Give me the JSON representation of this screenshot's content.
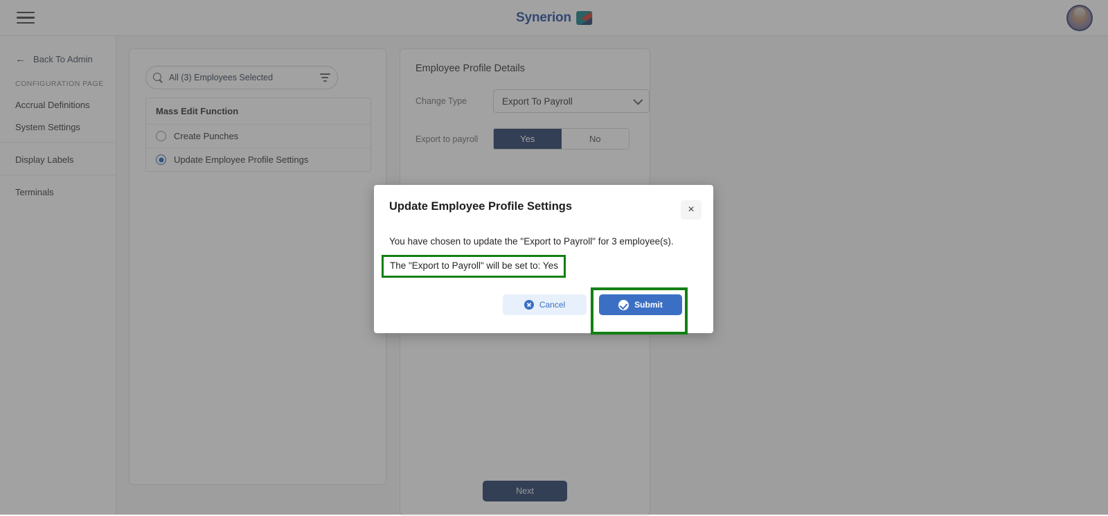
{
  "header": {
    "menu_icon": "hamburger-menu-icon",
    "logo_text": "Synerion",
    "logo_mark_icon": "synerion-logo-mark",
    "avatar_icon": "user-avatar"
  },
  "sidebar": {
    "back_arrow_icon": "arrow-left-icon",
    "back_label": "Back To Admin",
    "section_title": "CONFIGURATION PAGE",
    "groups": [
      {
        "items": [
          {
            "label": "Accrual Definitions"
          },
          {
            "label": "System Settings"
          }
        ]
      },
      {
        "items": [
          {
            "label": "Display Labels"
          }
        ]
      },
      {
        "items": [
          {
            "label": "Terminals"
          }
        ]
      }
    ]
  },
  "left_panel": {
    "search": {
      "icon": "search-icon",
      "value": "All (3) Employees Selected",
      "placeholder": "All (3) Employees Selected",
      "filter_icon": "filter-icon"
    },
    "mass_edit": {
      "header": "Mass Edit Function",
      "options": [
        {
          "label": "Create Punches",
          "selected": false
        },
        {
          "label": "Update Employee Profile Settings",
          "selected": true
        }
      ]
    }
  },
  "right_panel": {
    "title": "Employee Profile Details",
    "change_type": {
      "label": "Change Type",
      "value": "Export To Payroll",
      "chevron_icon": "chevron-down-icon"
    },
    "export_to_payroll": {
      "label": "Export to payroll",
      "options": [
        {
          "label": "Yes",
          "active": true
        },
        {
          "label": "No",
          "active": false
        }
      ]
    },
    "next_label": "Next"
  },
  "modal": {
    "title": "Update Employee Profile Settings",
    "close_icon": "close-icon",
    "close_label": "×",
    "message": "You have chosen to update the \"Export to Payroll\" for 3 employee(s).",
    "highlighted_message": "The \"Export to Payroll\" will be set to: Yes",
    "cancel_label": "Cancel",
    "cancel_icon": "cancel-circle-icon",
    "submit_label": "Submit",
    "submit_icon": "check-circle-icon"
  },
  "colors": {
    "brand_navy": "#1f3864",
    "brand_blue": "#3b6fc4",
    "logo_blue": "#1e4b9c",
    "highlight_green": "#128014",
    "cancel_bg": "#e8f0fb"
  }
}
